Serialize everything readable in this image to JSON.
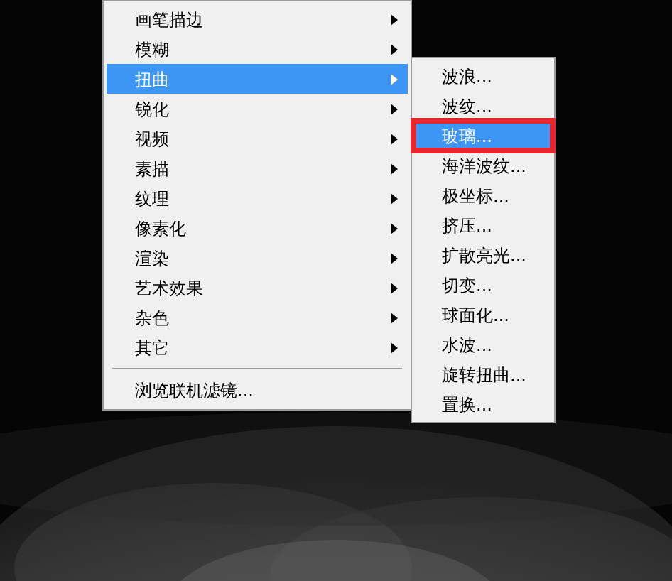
{
  "menu": {
    "items": [
      {
        "label": "画笔描边",
        "selected": false,
        "submenu": true
      },
      {
        "label": "模糊",
        "selected": false,
        "submenu": true
      },
      {
        "label": "扭曲",
        "selected": true,
        "submenu": true
      },
      {
        "label": "锐化",
        "selected": false,
        "submenu": true
      },
      {
        "label": "视频",
        "selected": false,
        "submenu": true
      },
      {
        "label": "素描",
        "selected": false,
        "submenu": true
      },
      {
        "label": "纹理",
        "selected": false,
        "submenu": true
      },
      {
        "label": "像素化",
        "selected": false,
        "submenu": true
      },
      {
        "label": "渲染",
        "selected": false,
        "submenu": true
      },
      {
        "label": "艺术效果",
        "selected": false,
        "submenu": true
      },
      {
        "label": "杂色",
        "selected": false,
        "submenu": true
      },
      {
        "label": "其它",
        "selected": false,
        "submenu": true
      },
      {
        "kind": "separator"
      },
      {
        "label": "浏览联机滤镜...",
        "selected": false,
        "submenu": false
      }
    ]
  },
  "submenu": {
    "items": [
      {
        "label": "波浪...",
        "selected": false,
        "outlined": false
      },
      {
        "label": "波纹...",
        "selected": false,
        "outlined": false
      },
      {
        "label": "玻璃...",
        "selected": true,
        "outlined": true
      },
      {
        "label": "海洋波纹...",
        "selected": false,
        "outlined": false
      },
      {
        "label": "极坐标...",
        "selected": false,
        "outlined": false
      },
      {
        "label": "挤压...",
        "selected": false,
        "outlined": false
      },
      {
        "label": "扩散亮光...",
        "selected": false,
        "outlined": false
      },
      {
        "label": "切变...",
        "selected": false,
        "outlined": false
      },
      {
        "label": "球面化...",
        "selected": false,
        "outlined": false
      },
      {
        "label": "水波...",
        "selected": false,
        "outlined": false
      },
      {
        "label": "旋转扭曲...",
        "selected": false,
        "outlined": false
      },
      {
        "label": "置换...",
        "selected": false,
        "outlined": false
      }
    ]
  }
}
